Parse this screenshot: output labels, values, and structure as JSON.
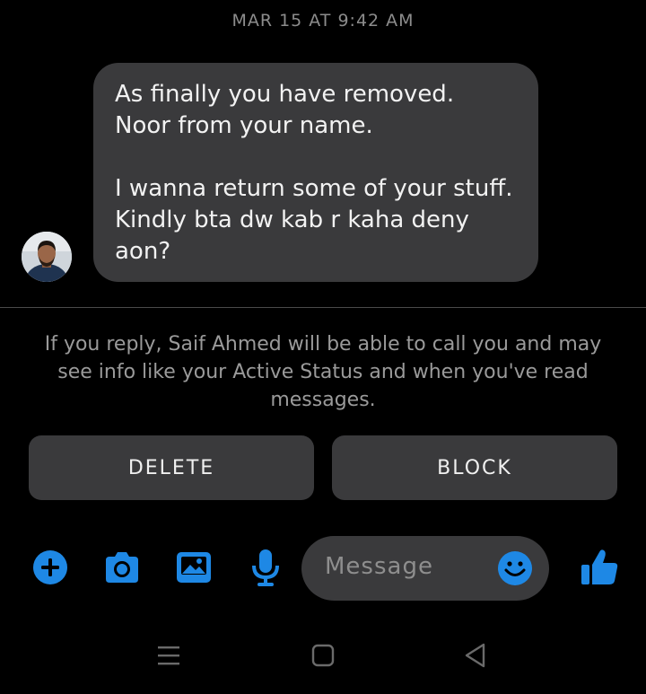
{
  "conversation": {
    "timestamp": "MAR 15 AT 9:42 AM",
    "message": {
      "text": "As finally you have removed.\nNoor from your name.\n\nI wanna return some of your stuff. Kindly bta dw kab r kaha deny aon?"
    }
  },
  "notice": {
    "text": "If you reply, Saif Ahmed will be able to call you and may see info like your Active Status and when you've read messages."
  },
  "actions": {
    "delete_label": "DELETE",
    "block_label": "BLOCK"
  },
  "composer": {
    "placeholder": "Message"
  },
  "colors": {
    "background": "#000000",
    "bubble": "#3a3a3c",
    "accent": "#1e88e5",
    "muted_text": "#9a9a9a"
  },
  "icons": {
    "toolbar": [
      "add-icon",
      "camera-icon",
      "gallery-icon",
      "microphone-icon"
    ],
    "composer": "emoji-icon",
    "send": "thumbs-up-icon",
    "navbar": [
      "recent-apps-icon",
      "home-icon",
      "back-icon"
    ]
  }
}
